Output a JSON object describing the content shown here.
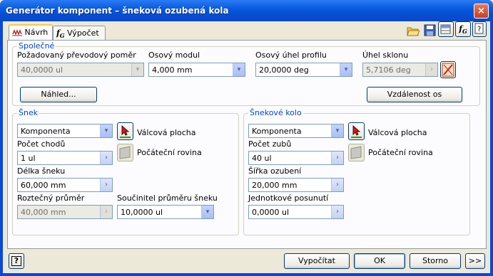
{
  "window": {
    "title": "Generátor komponent – šneková ozubená kola",
    "close_glyph": "×"
  },
  "tabs": [
    {
      "label": "Návrh"
    },
    {
      "label": "Výpočet"
    }
  ],
  "common": {
    "legend": "Společné",
    "ratio": {
      "label": "Požadovaný převodový poměr",
      "value": "40,0000 ul"
    },
    "module": {
      "label": "Osový modul",
      "value": "4,000 mm"
    },
    "pressure_angle": {
      "label": "Osový úhel profilu",
      "value": "20,0000 deg"
    },
    "helix_angle": {
      "label": "Úhel sklonu",
      "value": "5,7106 deg"
    },
    "preview_button": "Náhled...",
    "center_distance_button": "Vzdálenost os"
  },
  "worm": {
    "legend": "Šnek",
    "type_value": "Komponenta",
    "cylindrical_face": "Válcová plocha",
    "start_plane": "Počáteční rovina",
    "starts_label": "Počet chodů",
    "starts_value": "1 ul",
    "length_label": "Délka šneku",
    "length_value": "60,000 mm",
    "pitch_diameter_label": "Roztečný průměr",
    "pitch_diameter_value": "40,000 mm",
    "diameter_factor_label": "Součinitel průměru šneku",
    "diameter_factor_value": "10,0000 ul"
  },
  "wheel": {
    "legend": "Šnekové kolo",
    "type_value": "Komponenta",
    "cylindrical_face": "Válcová plocha",
    "start_plane": "Počáteční rovina",
    "teeth_label": "Počet zubů",
    "teeth_value": "40 ul",
    "face_width_label": "Šířka ozubení",
    "face_width_value": "20,000 mm",
    "shift_label": "Jednotkové posunutí",
    "shift_value": "0,0000 ul"
  },
  "footer": {
    "help": "?",
    "calculate": "Vypočítat",
    "ok": "OK",
    "cancel": "Storno",
    "more": ">>"
  },
  "icons": {
    "down": "▾",
    "right": "›"
  }
}
